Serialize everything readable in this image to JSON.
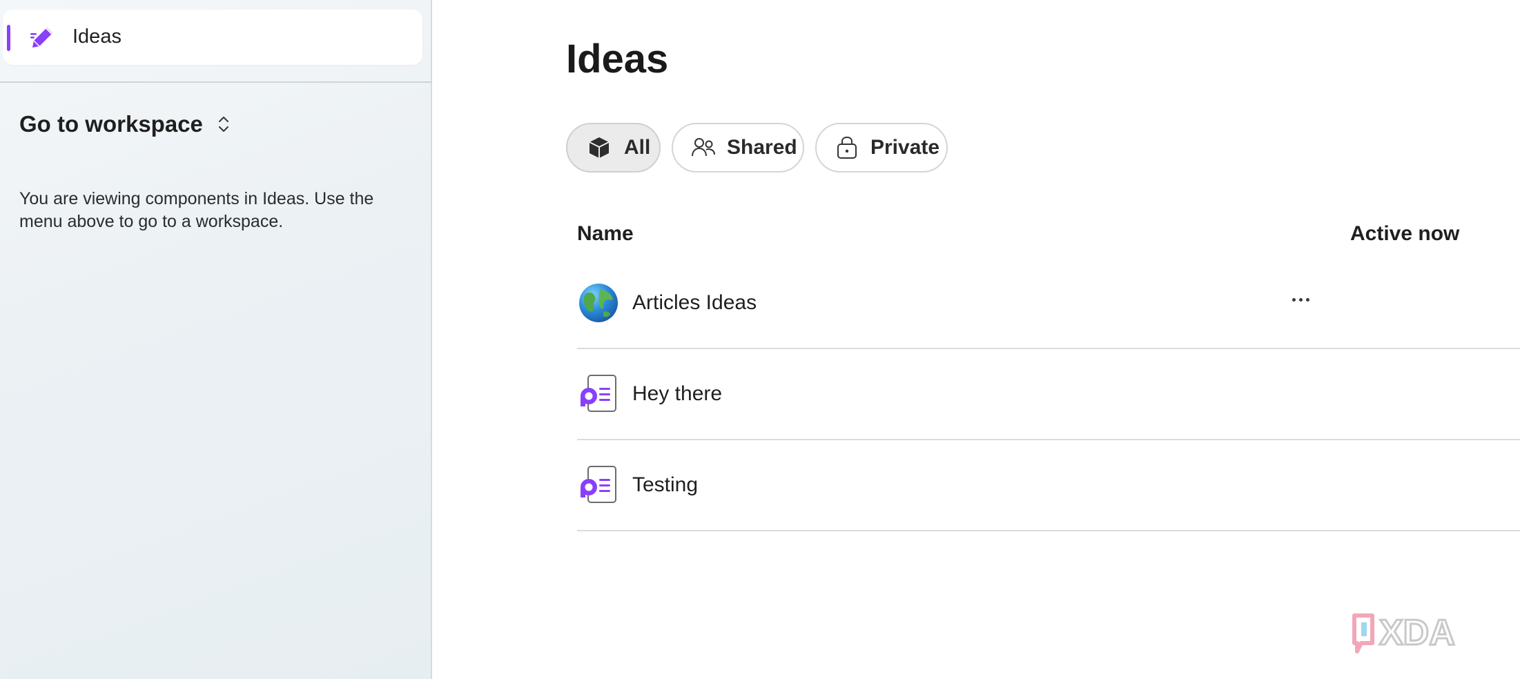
{
  "sidebar": {
    "nav": {
      "label": "Ideas",
      "icon": "pen-icon",
      "accent": "#8a3ffc"
    },
    "workspace": {
      "label": "Go to workspace",
      "icon": "chevron-up-down-icon"
    },
    "note": "You are viewing components in Ideas. Use the menu above to go to a workspace."
  },
  "main": {
    "title": "Ideas",
    "filters": [
      {
        "label": "All",
        "icon": "cube-icon",
        "selected": true
      },
      {
        "label": "Shared",
        "icon": "people-icon",
        "selected": false
      },
      {
        "label": "Private",
        "icon": "lock-icon",
        "selected": false
      }
    ],
    "columns": {
      "name": "Name",
      "active": "Active now"
    },
    "rows": [
      {
        "name": "Articles Ideas",
        "icon": "globe-icon",
        "has_more_menu": true
      },
      {
        "name": "Hey there",
        "icon": "loop-page-icon",
        "has_more_menu": false
      },
      {
        "name": "Testing",
        "icon": "loop-page-icon",
        "has_more_menu": false
      }
    ]
  },
  "watermark": {
    "text": "XDA"
  },
  "colors": {
    "accent": "#8a3ffc",
    "sidebar_bg": "#ecf1f4"
  }
}
